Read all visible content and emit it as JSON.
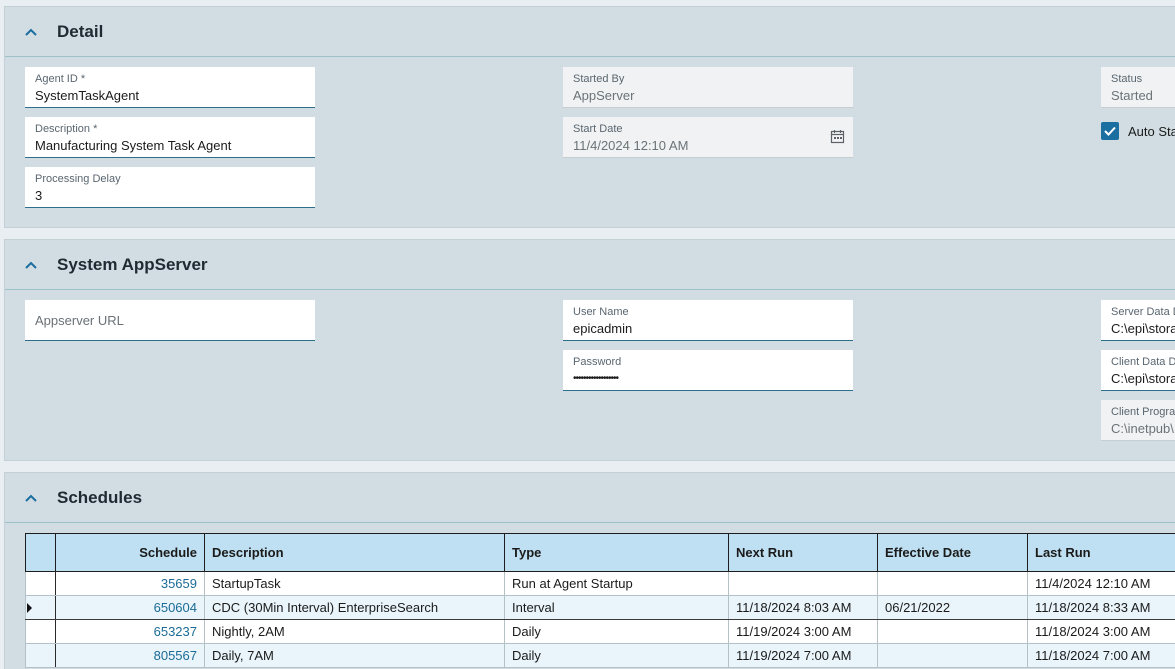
{
  "detail": {
    "title": "Detail",
    "agent_id": {
      "label": "Agent ID *",
      "value": "SystemTaskAgent"
    },
    "description": {
      "label": "Description *",
      "value": "Manufacturing System Task Agent"
    },
    "processing_delay": {
      "label": "Processing Delay",
      "value": "3"
    },
    "started_by": {
      "label": "Started By",
      "value": "AppServer"
    },
    "start_date": {
      "label": "Start Date",
      "value": "11/4/2024 12:10 AM"
    },
    "status": {
      "label": "Status",
      "value": "Started"
    },
    "auto_start": {
      "label": "Auto Sta",
      "checked": true
    }
  },
  "appserver": {
    "title": "System AppServer",
    "url_placeholder": "Appserver URL",
    "user_name": {
      "label": "User Name",
      "value": "epicadmin"
    },
    "password": {
      "label": "Password",
      "value": "••••••••••••••••••"
    },
    "server_data": {
      "label": "Server Data D",
      "value": "C:\\epi\\stora"
    },
    "client_data": {
      "label": "Client Data D",
      "value": "C:\\epi\\stora"
    },
    "client_program": {
      "label": "Client Progra",
      "value": "C:\\inetpub\\"
    }
  },
  "schedules": {
    "title": "Schedules",
    "columns": [
      "Schedule",
      "Description",
      "Type",
      "Next Run",
      "Effective Date",
      "Last Run"
    ],
    "rows": [
      {
        "schedule": "35659",
        "description": "StartupTask",
        "type": "Run at Agent Startup",
        "next_run": "",
        "effective_date": "",
        "last_run": "11/4/2024 12:10 AM"
      },
      {
        "schedule": "650604",
        "description": "CDC (30Min Interval) EnterpriseSearch",
        "type": "Interval",
        "next_run": "11/18/2024 8:03 AM",
        "effective_date": "06/21/2022",
        "last_run": "11/18/2024 8:33 AM"
      },
      {
        "schedule": "653237",
        "description": "Nightly, 2AM",
        "type": "Daily",
        "next_run": "11/19/2024 3:00 AM",
        "effective_date": "",
        "last_run": "11/18/2024 3:00 AM"
      },
      {
        "schedule": "805567",
        "description": "Daily, 7AM",
        "type": "Daily",
        "next_run": "11/19/2024 7:00 AM",
        "effective_date": "",
        "last_run": "11/18/2024 7:00 AM"
      }
    ],
    "selected_row": 1
  },
  "colors": {
    "panel_bg": "#d1dde2",
    "header_bg": "#bfe0f2",
    "accent": "#1a6ea0",
    "link": "#1c6b96"
  },
  "icons": {
    "collapse": "chevron-up-icon",
    "calendar": "calendar-icon",
    "check": "checkmark-icon",
    "row_indicator": "row-pointer-icon"
  }
}
